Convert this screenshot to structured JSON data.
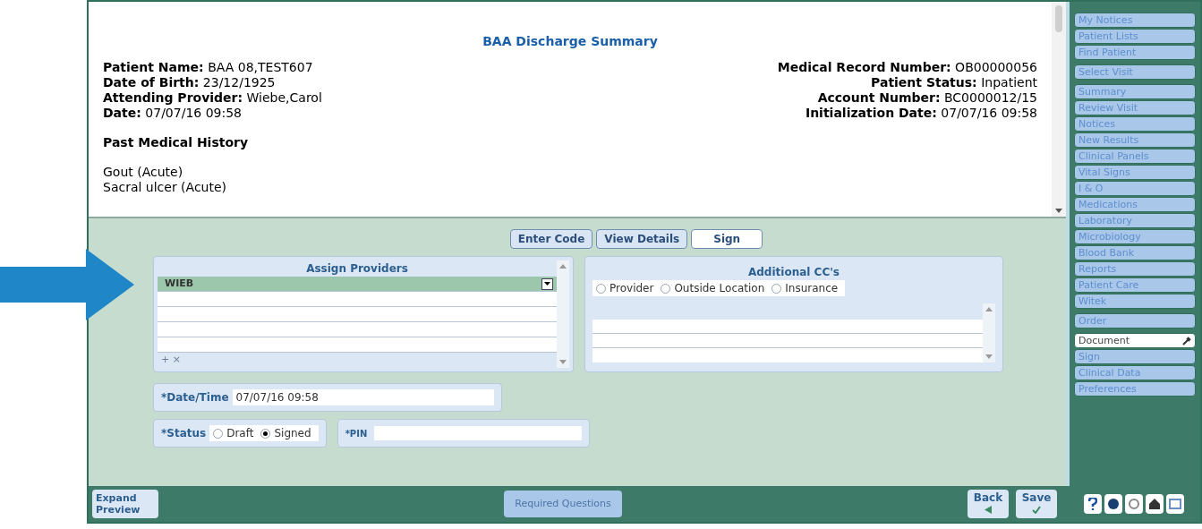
{
  "preview": {
    "title": "BAA Discharge Summary",
    "left_fields": [
      {
        "label": "Patient Name:",
        "value": "BAA 08,TEST607"
      },
      {
        "label": "Date of Birth:",
        "value": "23/12/1925"
      },
      {
        "label": "Attending Provider:",
        "value": "Wiebe,Carol"
      },
      {
        "label": "Date:",
        "value": "07/07/16 09:58"
      }
    ],
    "right_fields": [
      {
        "label": "Medical Record Number:",
        "value": "OB00000056"
      },
      {
        "label": "Patient Status:",
        "value": "Inpatient"
      },
      {
        "label": "Account Number:",
        "value": "BC0000012/15"
      },
      {
        "label": "Initialization Date:",
        "value": "07/07/16 09:58"
      }
    ],
    "section_title": "Past Medical History",
    "history": [
      "Gout (Acute)",
      "Sacral ulcer (Acute)"
    ]
  },
  "toolbar": [
    {
      "label": "Enter Code",
      "selected": false
    },
    {
      "label": "View Details",
      "selected": false
    },
    {
      "label": "Sign",
      "selected": true
    }
  ],
  "assign_providers": {
    "title": "Assign Providers",
    "rows": [
      {
        "text": "WIEB",
        "selected": true
      },
      {
        "selected": false
      },
      {
        "selected": false
      },
      {
        "selected": false
      },
      {
        "selected": false
      }
    ],
    "add_remove": "+ ×"
  },
  "additional_ccs": {
    "title": "Additional CC's",
    "options": [
      {
        "label": "Provider",
        "selected": false
      },
      {
        "label": "Outside Location",
        "selected": false
      },
      {
        "label": "Insurance",
        "selected": false
      }
    ]
  },
  "datetime": {
    "label": "*Date/Time",
    "value": "07/07/16 09:58"
  },
  "status": {
    "label": "*Status",
    "options": [
      {
        "label": "Draft",
        "selected": false
      },
      {
        "label": "Signed",
        "selected": true
      }
    ]
  },
  "pin": {
    "label": "*PIN"
  },
  "bottom": {
    "expand": "Expand Preview",
    "required": "Required Questions",
    "required_disabled": true,
    "back": "Back",
    "save": "Save"
  },
  "sidebar": [
    {
      "items": [
        {
          "label": "My Notices",
          "selected": false
        },
        {
          "label": "Patient Lists",
          "selected": false
        },
        {
          "label": "Find Patient",
          "selected": false
        }
      ]
    },
    {
      "items": [
        {
          "label": "Select Visit",
          "selected": false
        }
      ]
    },
    {
      "items": [
        {
          "label": "Summary",
          "selected": false
        },
        {
          "label": "Review Visit",
          "selected": false
        },
        {
          "label": "Notices",
          "selected": false
        },
        {
          "label": "New Results",
          "selected": false
        },
        {
          "label": "Clinical Panels",
          "selected": false
        },
        {
          "label": "Vital Signs",
          "selected": false
        },
        {
          "label": "I & O",
          "selected": false
        },
        {
          "label": "Medications",
          "selected": false
        },
        {
          "label": "Laboratory",
          "selected": false
        },
        {
          "label": "Microbiology",
          "selected": false
        },
        {
          "label": "Blood Bank",
          "selected": false
        },
        {
          "label": "Reports",
          "selected": false
        },
        {
          "label": "Patient Care",
          "selected": false
        },
        {
          "label": "Witek",
          "selected": false
        }
      ]
    },
    {
      "items": [
        {
          "label": "Order",
          "selected": false
        }
      ]
    },
    {
      "items": [
        {
          "label": "Document",
          "selected": true
        },
        {
          "label": "Sign",
          "selected": false
        },
        {
          "label": "Clinical Data",
          "selected": false
        },
        {
          "label": "Preferences",
          "selected": false
        }
      ]
    }
  ]
}
